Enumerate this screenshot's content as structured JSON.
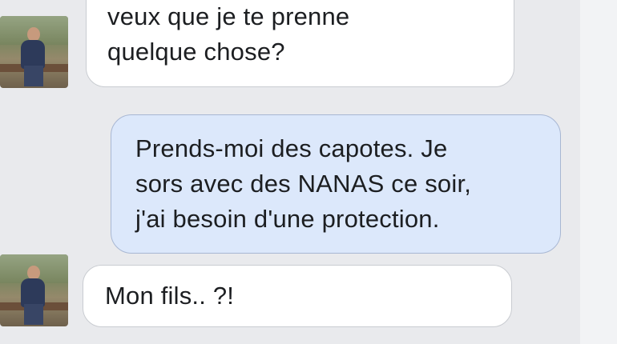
{
  "conversation": {
    "messages": [
      {
        "direction": "incoming",
        "lines": [
          "veux que je te prenne",
          "quelque chose?"
        ],
        "avatar_icon": "person-photo-avatar"
      },
      {
        "direction": "outgoing",
        "lines": [
          "Prends-moi des capotes. Je",
          "sors avec des NANAS ce soir,",
          "j'ai besoin d'une protection."
        ]
      },
      {
        "direction": "incoming",
        "lines": [
          "Mon fils.. ?!"
        ],
        "avatar_icon": "person-photo-avatar"
      }
    ]
  },
  "colors": {
    "background": "#e9eaed",
    "incoming_bubble": "#ffffff",
    "outgoing_bubble": "#dce8fb",
    "text": "#1c1e21"
  }
}
